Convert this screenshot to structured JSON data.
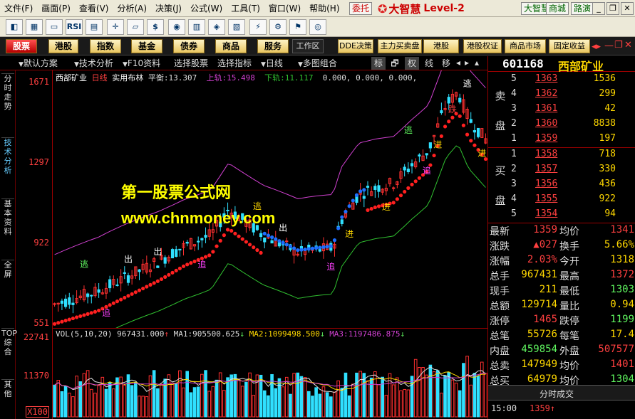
{
  "menu": [
    "文件(F)",
    "画面(P)",
    "查看(V)",
    "分析(A)",
    "决策(J)",
    "公式(W)",
    "工具(T)",
    "窗口(W)",
    "帮助(H)"
  ],
  "top_buttons": {
    "entrust": "委托",
    "dazhihui": "大智慧",
    "mall": "商城",
    "roadshow": "路演"
  },
  "logo": {
    "brand": "大智慧",
    "level": "Level-2"
  },
  "toolbar_icons": [
    "k-line-icon",
    "chart-icon",
    "monitor-icon",
    "rsi-icon",
    "grid-icon",
    "compass-icon",
    "ruler-icon",
    "dollar-icon",
    "eye-icon",
    "bars-icon",
    "binoculars-icon",
    "chart-down-icon",
    "lightning-icon",
    "settings-icon",
    "network-icon",
    "globe-icon"
  ],
  "toolbar_rsi_label": "RSI",
  "tabs": [
    "股票",
    "港股",
    "指数",
    "基金",
    "债券",
    "商品",
    "服务"
  ],
  "tabs_right": [
    "工作区",
    "DDE决策",
    "主力买卖盘",
    "港股",
    "港股权证",
    "商品市场",
    "固定收益"
  ],
  "options": {
    "default_scheme": "默认方案",
    "tech_analysis": "技术分析",
    "f10": "F10资料",
    "pick_stock": "选择股票",
    "pick_indicator": "选择指标",
    "period": "日线",
    "multi_chart": "多图组合",
    "cycles": [
      "标",
      "🗗",
      "权",
      "线",
      "移"
    ]
  },
  "side_tabs": [
    "分时走势",
    "技术分析",
    "基本资料",
    "全屏",
    "TOP综合",
    "其他"
  ],
  "chart_header": {
    "stock": "西部矿业",
    "period": "日线",
    "indicator": "实用布林",
    "balance_label": "平衡:",
    "balance": "13.307",
    "up_label": "上轨:",
    "up": "15.498",
    "down_label": "下轨:",
    "down": "11.117",
    "rest": "0.000, 0.000, 0.000,"
  },
  "price_axis": [
    "1671",
    "1297",
    "922",
    "551"
  ],
  "vol_axis": [
    "22741",
    "11370",
    "X100"
  ],
  "vol_header": {
    "label": "VOL(5,10,20)",
    "vol": "967431.000",
    "ma1_label": "MA1:",
    "ma1": "905500.625",
    "ma2_label": "MA2:",
    "ma2": "1099498.500",
    "ma3_label": "MA3:",
    "ma3": "1197486.875"
  },
  "watermark": {
    "line1": "第一股票公式网",
    "line2": "www.chnmoney.com"
  },
  "signals": {
    "escape": "逃",
    "out": "出",
    "in": "进",
    "chase": "追",
    "fall": "跌",
    "buy": "必买"
  },
  "stock": {
    "code": "601168",
    "name": "西部矿业"
  },
  "orderbook": {
    "sell_label": [
      "卖",
      "盘"
    ],
    "buy_label": [
      "买",
      "盘"
    ],
    "sell": [
      {
        "i": "5",
        "p": "1363",
        "v": "1536"
      },
      {
        "i": "4",
        "p": "1362",
        "v": "299"
      },
      {
        "i": "3",
        "p": "1361",
        "v": "42"
      },
      {
        "i": "2",
        "p": "1360",
        "v": "8838"
      },
      {
        "i": "1",
        "p": "1359",
        "v": "197"
      }
    ],
    "buy": [
      {
        "i": "1",
        "p": "1358",
        "v": "718"
      },
      {
        "i": "2",
        "p": "1357",
        "v": "330"
      },
      {
        "i": "3",
        "p": "1356",
        "v": "436"
      },
      {
        "i": "4",
        "p": "1355",
        "v": "922"
      },
      {
        "i": "5",
        "p": "1354",
        "v": "94"
      }
    ]
  },
  "quotes": [
    {
      "l1": "最新",
      "v1": "1359",
      "c1": "#ff4040",
      "l2": "均价",
      "v2": "1341",
      "c2": "#ff4040"
    },
    {
      "l1": "涨跌",
      "v1": "▲027",
      "c1": "#ff4040",
      "l2": "换手",
      "v2": "5.66%",
      "c2": "#ffd800"
    },
    {
      "l1": "涨幅",
      "v1": "2.03%",
      "c1": "#ff4040",
      "l2": "今开",
      "v2": "1318",
      "c2": "#ffd800"
    },
    {
      "l1": "总手",
      "v1": "967431",
      "c1": "#ffd800",
      "l2": "最高",
      "v2": "1372",
      "c2": "#ff4040"
    },
    {
      "l1": "现手",
      "v1": "211",
      "c1": "#ffd800",
      "l2": "最低",
      "v2": "1303",
      "c2": "#5ff55f"
    },
    {
      "l1": "总额",
      "v1": "129714",
      "c1": "#ffd800",
      "l2": "量比",
      "v2": "0.94",
      "c2": "#ffd800"
    },
    {
      "l1": "涨停",
      "v1": "1465",
      "c1": "#ff4040",
      "l2": "跌停",
      "v2": "1199",
      "c2": "#5ff55f"
    },
    {
      "l1": "总笔",
      "v1": "55726",
      "c1": "#ffd800",
      "l2": "每笔",
      "v2": "17.4",
      "c2": "#ffd800"
    },
    {
      "l1": "内盘",
      "v1": "459854",
      "c1": "#5ff55f",
      "l2": "外盘",
      "v2": "507577",
      "c2": "#ff4040"
    },
    {
      "l1": "总卖",
      "v1": "147949",
      "c1": "#ffd800",
      "l2": "均价",
      "v2": "1401",
      "c2": "#ff4040"
    },
    {
      "l1": "总买",
      "v1": "64979",
      "c1": "#ffd800",
      "l2": "均价",
      "v2": "1304",
      "c2": "#5ff55f"
    }
  ],
  "tick_tab": "分时成交",
  "tick": {
    "time": "15:00",
    "price": "1359↑"
  },
  "colors": {
    "up": "#ff3030",
    "down": "#30e0ff",
    "sar_up": "#ff2020",
    "sar_down": "#1e6fff",
    "upper": "#d040d0",
    "lower": "#30c030",
    "mid": "#c8c8c8"
  }
}
